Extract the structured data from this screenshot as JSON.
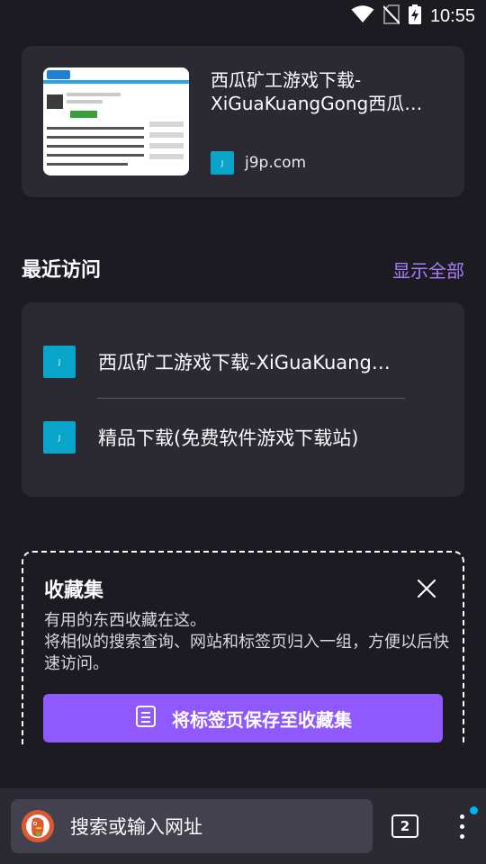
{
  "status_bar": {
    "time": "10:55"
  },
  "recent_tab": {
    "title_line1": "西瓜矿工游戏下载-",
    "title_line2": "XiGuaKuangGong西瓜…",
    "domain": "j9p.com",
    "favicon_glyph": "J"
  },
  "recent_visits": {
    "section_title": "最近访问",
    "show_all_label": "显示全部",
    "items": [
      {
        "title": "西瓜矿工游戏下载-XiGuaKuangGong西瓜矿工",
        "favicon_glyph": "J"
      },
      {
        "title": "精品下载(免费软件游戏下载站)",
        "favicon_glyph": "J"
      }
    ]
  },
  "collections": {
    "title": "收藏集",
    "description_line1": "有用的东西收藏在这。",
    "description_line2": "将相似的搜索查询、网站和标签页归入一组，方便以后快速访问。",
    "save_button_label": "将标签页保存至收藏集"
  },
  "toolbar": {
    "search_placeholder": "搜索或输入网址",
    "tab_count": "2",
    "search_engine_icon": "duckduckgo-icon"
  },
  "colors": {
    "background": "#1c1b22",
    "card": "#2b2a33",
    "accent": "#9059ff",
    "link": "#a67ef8",
    "favicon": "#0aa3c9",
    "notification_dot": "#00b3f4"
  }
}
